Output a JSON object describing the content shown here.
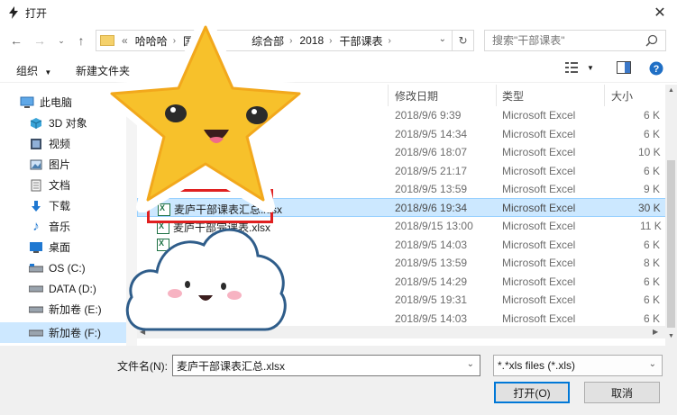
{
  "window": {
    "title": "打开",
    "close_label": "✕"
  },
  "address": {
    "crumbs": [
      "«",
      "哈哈哈",
      "国",
      "综合部",
      "2018",
      "干部课表"
    ],
    "search_placeholder": "搜索\"干部课表\""
  },
  "toolbar": {
    "organize": "组织",
    "new_folder": "新建文件夹"
  },
  "nav": [
    {
      "label": "此电脑",
      "icon": "pc-icon"
    },
    {
      "label": "3D 对象",
      "icon": "3d-objects-icon"
    },
    {
      "label": "视频",
      "icon": "video-icon"
    },
    {
      "label": "图片",
      "icon": "pictures-icon"
    },
    {
      "label": "文档",
      "icon": "documents-icon"
    },
    {
      "label": "下载",
      "icon": "download-icon"
    },
    {
      "label": "音乐",
      "icon": "music-icon"
    },
    {
      "label": "桌面",
      "icon": "desktop-icon"
    },
    {
      "label": "OS (C:)",
      "icon": "drive-icon"
    },
    {
      "label": "DATA (D:)",
      "icon": "drive-icon"
    },
    {
      "label": "新加卷 (E:)",
      "icon": "drive-icon"
    },
    {
      "label": "新加卷 (F:)",
      "icon": "drive-icon"
    }
  ],
  "columns": {
    "date": "修改日期",
    "type": "类型",
    "size": "大小"
  },
  "files": [
    {
      "name": "",
      "date": "2018/9/6 9:39",
      "type": "Microsoft Excel",
      "size": "6 K"
    },
    {
      "name": "",
      "date": "2018/9/5 14:34",
      "type": "Microsoft Excel",
      "size": "6 K"
    },
    {
      "name": "",
      "date": "2018/9/6 18:07",
      "type": "Microsoft Excel",
      "size": "10 K"
    },
    {
      "name": "",
      "date": "2018/9/5 21:17",
      "type": "Microsoft Excel",
      "size": "6 K"
    },
    {
      "name": "",
      "date": "2018/9/5 13:59",
      "type": "Microsoft Excel",
      "size": "9 K"
    },
    {
      "name": "麦庐干部课表汇总.xlsx",
      "date": "2018/9/6 19:34",
      "type": "Microsoft Excel",
      "size": "30 K"
    },
    {
      "name": "麦庐干部完课表.xlsx",
      "date": "2018/9/15 13:00",
      "type": "Microsoft Excel",
      "size": "11 K"
    },
    {
      "name": "",
      "date": "2018/9/5 14:03",
      "type": "Microsoft Excel",
      "size": "6 K"
    },
    {
      "name": "",
      "date": "2018/9/5 13:59",
      "type": "Microsoft Excel",
      "size": "8 K"
    },
    {
      "name": "",
      "date": "2018/9/5 14:29",
      "type": "Microsoft Excel",
      "size": "6 K"
    },
    {
      "name": "",
      "date": "2018/9/5 19:31",
      "type": "Microsoft Excel",
      "size": "6 K"
    },
    {
      "name": "",
      "date": "2018/9/5 14:03",
      "type": "Microsoft Excel",
      "size": "6 K"
    }
  ],
  "bottom": {
    "filename_label": "文件名(N):",
    "filename_value": "麦庐干部课表汇总.xlsx",
    "filter_value": "*.*xls files (*.xls)",
    "open_label": "打开(O)",
    "cancel_label": "取消"
  },
  "colors": {
    "selection": "#cce8ff",
    "highlight": "#e02020",
    "accent": "#0078d7"
  }
}
